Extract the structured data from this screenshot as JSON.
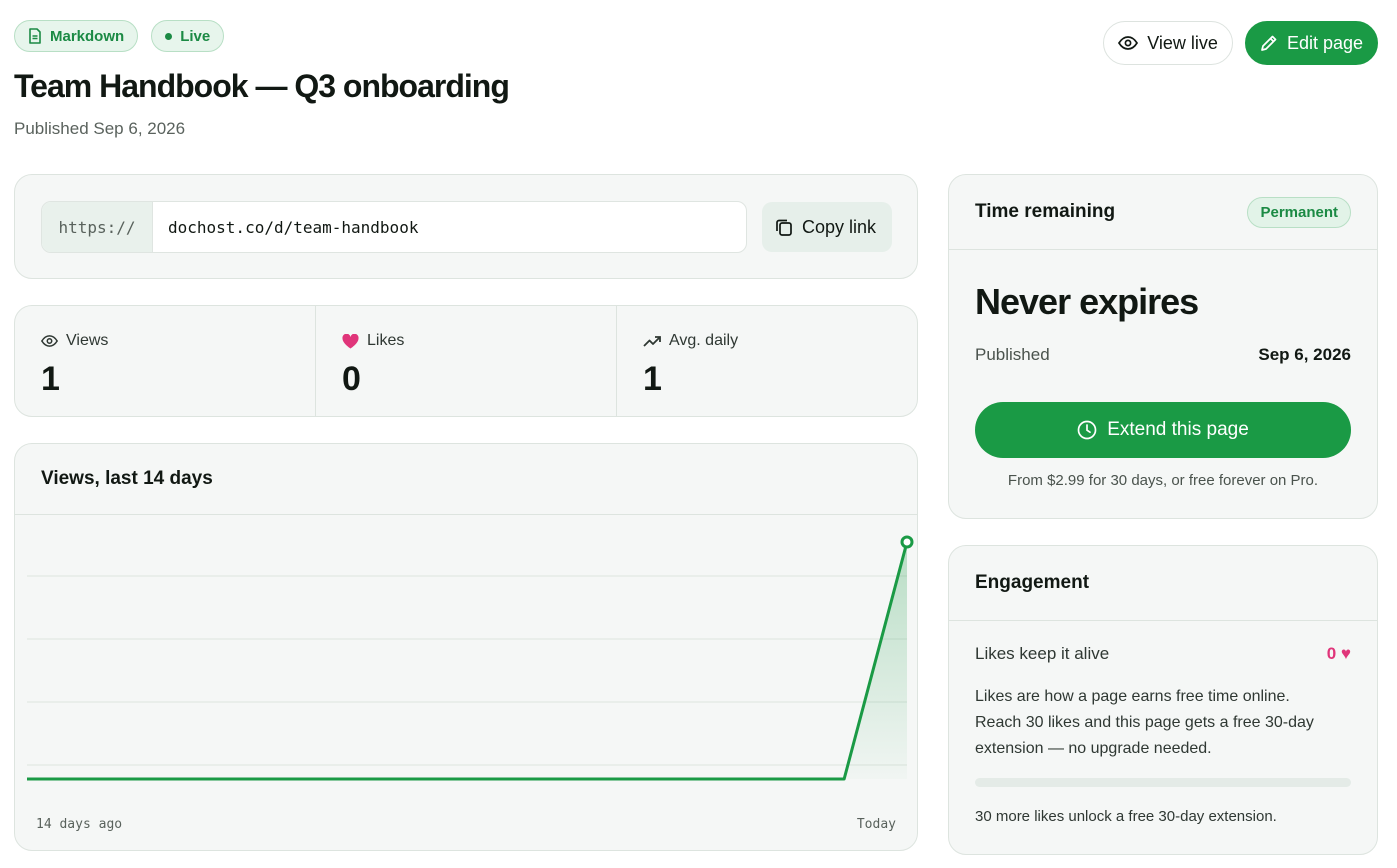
{
  "header": {
    "badges": [
      {
        "label": "Markdown",
        "icon": "document-icon"
      },
      {
        "label": "Live",
        "icon": "status-dot"
      }
    ],
    "title": "Team Handbook — Q3 onboarding",
    "subtitle": "Published Sep 6, 2026",
    "actions": {
      "view_live": "View live",
      "edit_page": "Edit page"
    }
  },
  "link": {
    "prefix": "https://",
    "url": "dochost.co/d/team-handbook",
    "copy_label": "Copy link"
  },
  "stats": [
    {
      "label": "Views",
      "value": "1",
      "icon": "eye-icon"
    },
    {
      "label": "Likes",
      "value": "0",
      "icon": "heart-icon"
    },
    {
      "label": "Avg. daily",
      "value": "1",
      "icon": "trend-up-icon"
    }
  ],
  "chart": {
    "title": "Views, last 14 days",
    "start_label": "14 days ago",
    "end_label": "Today"
  },
  "chart_data": {
    "type": "area",
    "title": "Views, last 14 days",
    "x": [
      "14 days ago",
      "",
      "",
      "",
      "",
      "",
      "",
      "",
      "",
      "",
      "",
      "",
      "",
      "",
      "Today"
    ],
    "series": [
      {
        "values": [
          0,
          0,
          0,
          0,
          0,
          0,
          0,
          0,
          0,
          0,
          0,
          0,
          0,
          0,
          1
        ]
      }
    ],
    "ylim": [
      0,
      1
    ],
    "grid": true,
    "color": "#1a9a45"
  },
  "time_remaining": {
    "title": "Time remaining",
    "badge": "Permanent",
    "headline": "Never expires",
    "published_label": "Published",
    "published_value": "Sep 6, 2026",
    "extend_label": "Extend this page",
    "note": "From $2.99 for 30 days, or free forever on Pro."
  },
  "engagement": {
    "title": "Engagement",
    "row_label": "Likes keep it alive",
    "likes_display": "0 ♥",
    "description": "Likes are how a page earns free time online. Reach 30 likes and this page gets a free 30-day extension — no upgrade needed.",
    "progress": 0,
    "footer": "30 more likes unlock a free 30-day extension."
  },
  "colors": {
    "accent": "#1a9a45",
    "badge_bg": "#e7f5ec",
    "like": "#e0357a"
  }
}
